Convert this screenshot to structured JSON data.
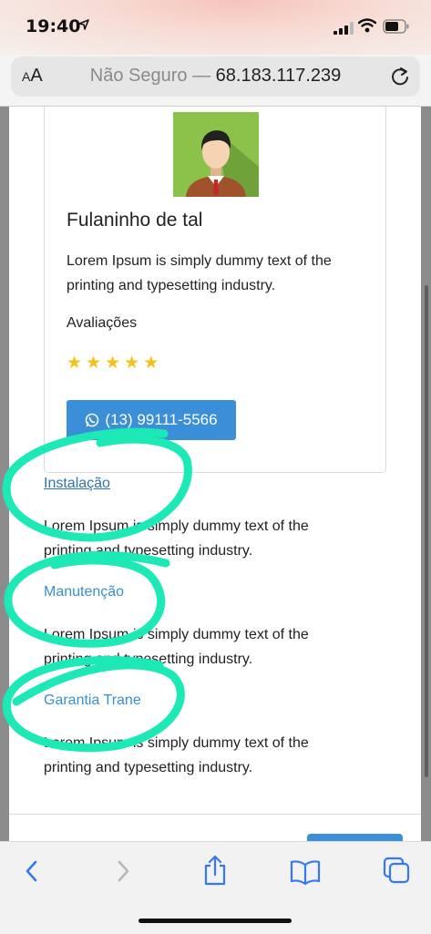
{
  "status_bar": {
    "time": "19:40"
  },
  "address_bar": {
    "aa_small": "A",
    "aa_large": "A",
    "prefix": "Não Seguro — ",
    "host": "68.183.117.239"
  },
  "card": {
    "name": "Fulaninho de tal",
    "description": "Lorem Ipsum is simply dummy text of the printing and typesetting industry.",
    "reviews_label": "Avaliações",
    "rating": 5,
    "stars": [
      "★",
      "★",
      "★",
      "★",
      "★"
    ],
    "phone_button": "(13) 99111-5566"
  },
  "services": [
    {
      "title": "Instalação",
      "description": "Lorem Ipsum is simply dummy text of the printing and typesetting industry."
    },
    {
      "title": "Manutenção",
      "description": "Lorem Ipsum is simply dummy text of the printing and typesetting industry."
    },
    {
      "title": "Garantia Trane",
      "description": "Lorem Ipsum is simply dummy text of the printing and typesetting industry."
    }
  ],
  "colors": {
    "accent": "#3a8fd8",
    "link": "#3a8fd0",
    "star": "#f3c11a",
    "annotation": "#1de9b6"
  },
  "toolbar": {
    "icons": [
      "back-icon",
      "forward-icon",
      "share-icon",
      "bookmarks-icon",
      "tabs-icon"
    ]
  }
}
